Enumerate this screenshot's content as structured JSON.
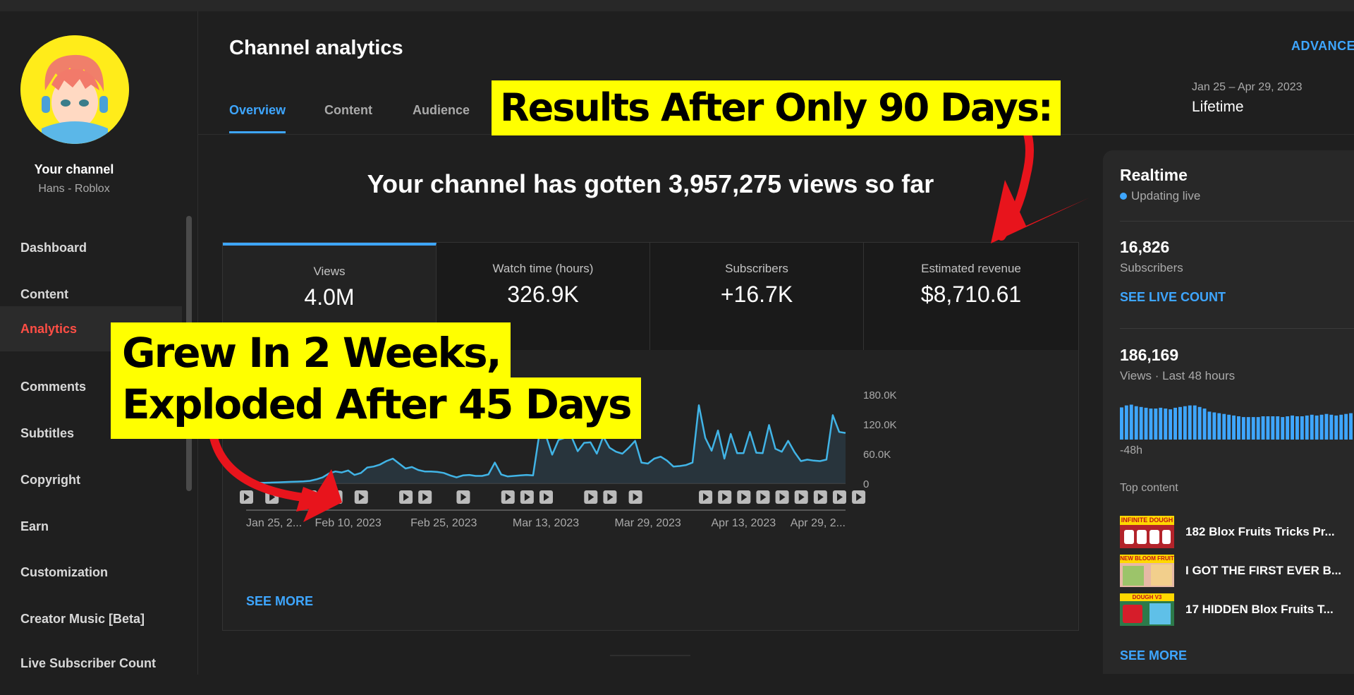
{
  "sidebar": {
    "channel_name": "Your channel",
    "channel_sub": "Hans - Roblox",
    "items": [
      {
        "label": "Dashboard"
      },
      {
        "label": "Content"
      },
      {
        "label": "Analytics",
        "active": true
      },
      {
        "label": "Comments"
      },
      {
        "label": "Subtitles"
      },
      {
        "label": "Copyright"
      },
      {
        "label": "Earn"
      },
      {
        "label": "Customization"
      },
      {
        "label": "Creator Music [Beta]"
      },
      {
        "label": "Live Subscriber Count"
      }
    ]
  },
  "header": {
    "title": "Channel analytics",
    "advanced": "ADVANCE",
    "tabs": [
      "Overview",
      "Content",
      "Audience"
    ],
    "date_range": "Jan 25 – Apr 29, 2023",
    "date_label": "Lifetime"
  },
  "overview": {
    "headline": "Your channel has gotten 3,957,275 views so far",
    "metrics": [
      {
        "label": "Views",
        "value": "4.0M"
      },
      {
        "label": "Watch time (hours)",
        "value": "326.9K"
      },
      {
        "label": "Subscribers",
        "value": "+16.7K"
      },
      {
        "label": "Estimated revenue",
        "value": "$8,710.61"
      }
    ],
    "see_more": "SEE MORE"
  },
  "chart_data": {
    "type": "area",
    "ylim": [
      0,
      180000
    ],
    "ytick_labels": [
      "180.0K",
      "120.0K",
      "60.0K",
      "0"
    ],
    "yticks": [
      180000,
      120000,
      60000,
      0
    ],
    "xtick_labels": [
      "Jan 25, 2...",
      "Feb 10, 2023",
      "Feb 25, 2023",
      "Mar 13, 2023",
      "Mar 29, 2023",
      "Apr 13, 2023",
      "Apr 29, 2..."
    ],
    "xtick_days": [
      0,
      16,
      31,
      47,
      63,
      78,
      94
    ],
    "x_days": [
      0,
      1,
      2,
      3,
      4,
      5,
      6,
      7,
      8,
      9,
      10,
      11,
      12,
      13,
      14,
      15,
      16,
      17,
      18,
      19,
      20,
      21,
      22,
      23,
      24,
      25,
      26,
      27,
      28,
      29,
      30,
      31,
      32,
      33,
      34,
      35,
      36,
      37,
      38,
      39,
      40,
      41,
      42,
      43,
      44,
      45,
      46,
      47,
      48,
      49,
      50,
      51,
      52,
      53,
      54,
      55,
      56,
      57,
      58,
      59,
      60,
      61,
      62,
      63,
      64,
      65,
      66,
      67,
      68,
      69,
      70,
      71,
      72,
      73,
      74,
      75,
      76,
      77,
      78,
      79,
      80,
      81,
      82,
      83,
      84,
      85,
      86,
      87,
      88,
      89,
      90,
      91,
      92,
      93,
      94
    ],
    "views": [
      1000,
      1000,
      1000,
      1000,
      1500,
      2000,
      2500,
      3000,
      3500,
      4000,
      5000,
      8000,
      12000,
      20000,
      24000,
      22000,
      26000,
      17000,
      21000,
      32000,
      34000,
      38000,
      45000,
      50000,
      40000,
      30000,
      33000,
      27000,
      24000,
      24000,
      23000,
      21000,
      16000,
      12000,
      16000,
      17000,
      15000,
      15000,
      18000,
      42000,
      18000,
      14000,
      15000,
      16000,
      17000,
      16000,
      102000,
      97000,
      58000,
      88000,
      92000,
      95000,
      65000,
      82000,
      83000,
      60000,
      95000,
      72000,
      64000,
      60000,
      72000,
      86000,
      42000,
      40000,
      50000,
      54000,
      46000,
      34000,
      35000,
      37000,
      42000,
      158000,
      92000,
      66000,
      107000,
      50000,
      100000,
      61000,
      61000,
      104000,
      62000,
      61000,
      118000,
      70000,
      64000,
      86000,
      63000,
      45000,
      48000,
      46000,
      45000,
      48000,
      138000,
      104000,
      102000
    ],
    "video_markers": [
      0,
      4,
      10,
      14,
      18,
      25,
      28,
      34,
      41,
      44,
      47,
      54,
      57,
      61,
      72,
      75,
      78,
      81,
      84,
      87,
      90,
      93,
      96
    ],
    "marker_counts": {
      "10": "3",
      "14": "2"
    }
  },
  "realtime": {
    "title": "Realtime",
    "status": "Updating live",
    "subscribers_value": "16,826",
    "subscribers_label": "Subscribers",
    "see_live_count": "SEE LIVE COUNT",
    "views_value": "186,169",
    "views_label": "Views · Last 48 hours",
    "bar_values": [
      0.83,
      0.88,
      0.9,
      0.86,
      0.84,
      0.82,
      0.8,
      0.8,
      0.82,
      0.8,
      0.78,
      0.82,
      0.84,
      0.86,
      0.88,
      0.88,
      0.84,
      0.8,
      0.72,
      0.7,
      0.68,
      0.66,
      0.64,
      0.62,
      0.6,
      0.58,
      0.58,
      0.58,
      0.58,
      0.6,
      0.6,
      0.6,
      0.6,
      0.58,
      0.6,
      0.62,
      0.6,
      0.6,
      0.62,
      0.64,
      0.62,
      0.64,
      0.66,
      0.64,
      0.62,
      0.64,
      0.66,
      0.68
    ],
    "bar_axis_label": "-48h",
    "top_content_label": "Top content",
    "top_content": [
      {
        "title": "182 Blox Fruits Tricks Pr...",
        "thumb_text": "INFINITE DOUGH"
      },
      {
        "title": "I GOT THE FIRST EVER B...",
        "thumb_text": "NEW BLOOM FRUIT"
      },
      {
        "title": "17 HIDDEN Blox Fruits T...",
        "thumb_text": "DOUGH V3"
      }
    ],
    "see_more": "SEE MORE"
  },
  "captions": {
    "results": "Results After Only 90 Days:",
    "grew_line1": "Grew In 2 Weeks,",
    "grew_line2": "Exploded After 45 Days"
  },
  "colors": {
    "accent": "#3ea6ff",
    "active_nav": "#ff4e45",
    "caption_bg": "#ffff00",
    "arrow": "#e8141c"
  }
}
